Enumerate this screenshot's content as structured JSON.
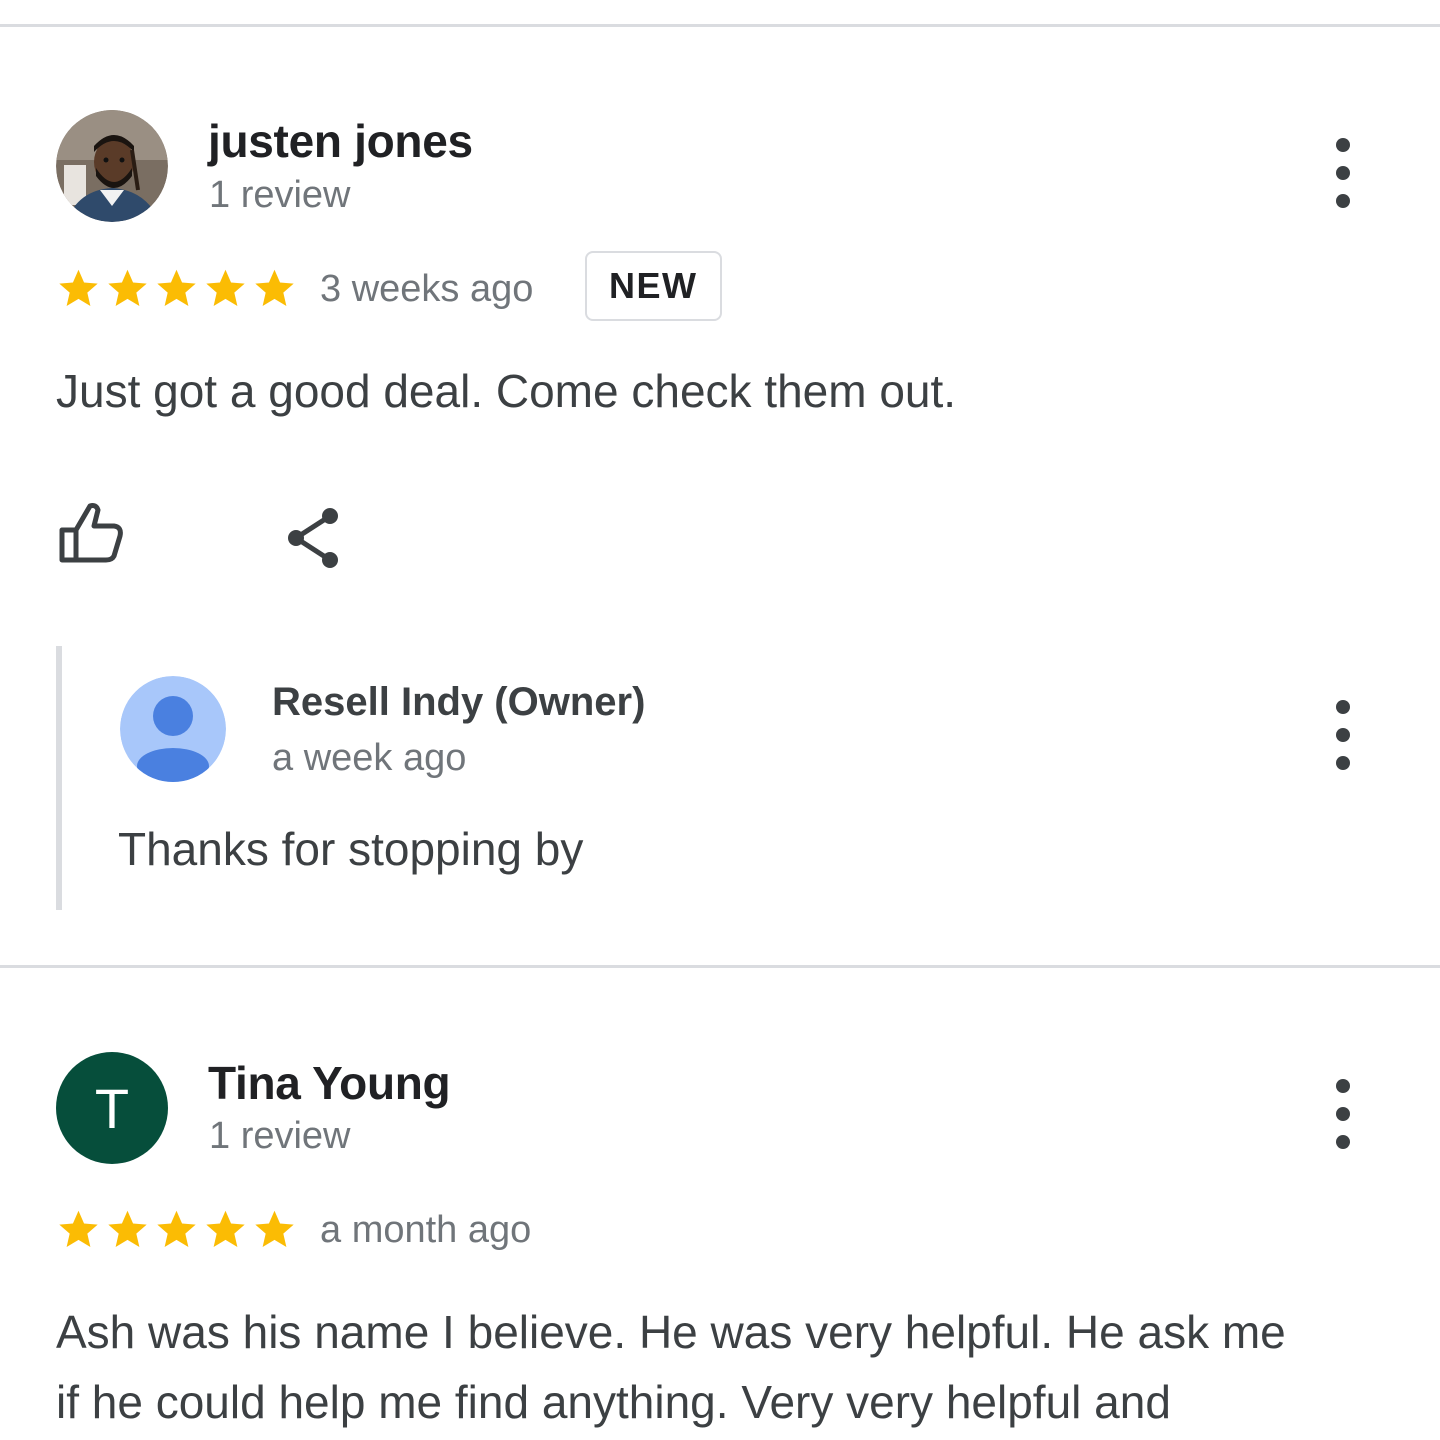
{
  "reviews": [
    {
      "name": "justen jones",
      "review_count": "1 review",
      "rating": 5,
      "time": "3 weeks ago",
      "badge": "NEW",
      "text": "Just got a good deal. Come check them out.",
      "owner_reply": {
        "name": "Resell Indy (Owner)",
        "time": "a week ago",
        "text": "Thanks for stopping by"
      }
    },
    {
      "name": "Tina Young",
      "avatar_letter": "T",
      "avatar_color": "#064e3b",
      "review_count": "1 review",
      "rating": 5,
      "time": "a month ago",
      "text_lines": [
        "Ash was his name I believe. He was very helpful. He ask me",
        "if he could help me find anything. Very very helpful and"
      ]
    }
  ],
  "icons": {
    "like": "thumbs-up-icon",
    "share": "share-icon",
    "more": "more-vert-icon",
    "star": "star-icon",
    "default_avatar": "person-icon"
  },
  "colors": {
    "star": "#fbbc04",
    "divider": "#dadce0",
    "muted_text": "#70757a"
  }
}
